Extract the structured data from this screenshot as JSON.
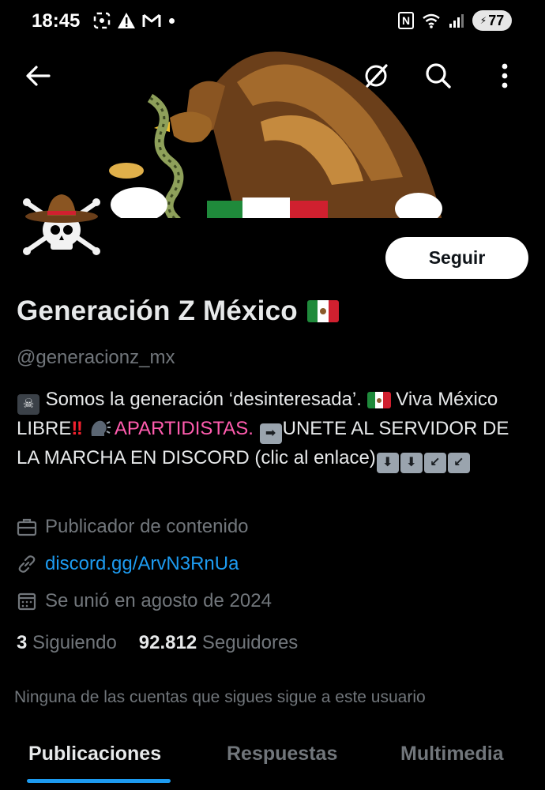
{
  "status_bar": {
    "time": "18:45",
    "battery": "77",
    "icons": [
      "screenshot-icon",
      "alert-icon",
      "gmail-icon",
      "nfc-icon",
      "wifi-icon",
      "signal-icon",
      "battery-icon"
    ]
  },
  "header": {
    "back_icon": "arrow-left-icon",
    "actions": [
      "grok-icon",
      "search-icon",
      "more-vert-icon"
    ]
  },
  "profile": {
    "follow_label": "Seguir",
    "display_name": "Generación Z México",
    "handle": "@generacionz_mx",
    "bio": {
      "part1": "Somos la generación ‘desinteresada’.",
      "part2": "Viva México LIBRE",
      "pink": "APARTIDISTAS.",
      "part3": "UNETE AL SERVIDOR DE LA MARCHA EN DISCORD (clic al enlace)"
    },
    "category": "Publicador de contenido",
    "link": "discord.gg/ArvN3RnUa",
    "joined": "Se unió en agosto de 2024",
    "following_count": "3",
    "following_label": "Siguiendo",
    "followers_count": "92.812",
    "followers_label": "Seguidores",
    "notice": "Ninguna de las cuentas que sigues sigue a este usuario"
  },
  "tabs": [
    {
      "label": "Publicaciones",
      "active": true
    },
    {
      "label": "Respuestas",
      "active": false
    },
    {
      "label": "Multimedia",
      "active": false
    }
  ],
  "colors": {
    "accent": "#1d9bf0",
    "pink": "#ff5cae",
    "muted": "#71767b"
  }
}
